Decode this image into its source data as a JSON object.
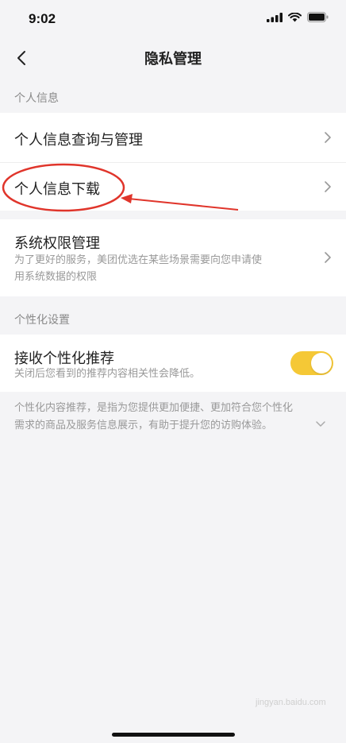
{
  "status_bar": {
    "time": "9:02"
  },
  "nav": {
    "title": "隐私管理"
  },
  "section_personal": {
    "header": "个人信息"
  },
  "personal_items": [
    {
      "title": "个人信息查询与管理"
    },
    {
      "title": "个人信息下载"
    }
  ],
  "system_permission": {
    "title": "系统权限管理",
    "subtitle_line1": "为了更好的服务，美团优选在某些场景需要向您申请使",
    "subtitle_line2": "用系统数据的权限"
  },
  "section_personalization": {
    "header": "个性化设置"
  },
  "personalization": {
    "title": "接收个性化推荐",
    "subtitle": "关闭后您看到的推荐内容相关性会降低。",
    "enabled": true
  },
  "description": {
    "line1": "个性化内容推荐，是指为您提供更加便捷、更加符合您个性化",
    "line2": "需求的商品及服务信息展示，有助于提升您的访购体验。"
  },
  "watermark": "jingyan.baidu.com",
  "colors": {
    "toggle_on": "#f5c836",
    "annotation": "#e0352b",
    "background": "#f4f4f6"
  }
}
